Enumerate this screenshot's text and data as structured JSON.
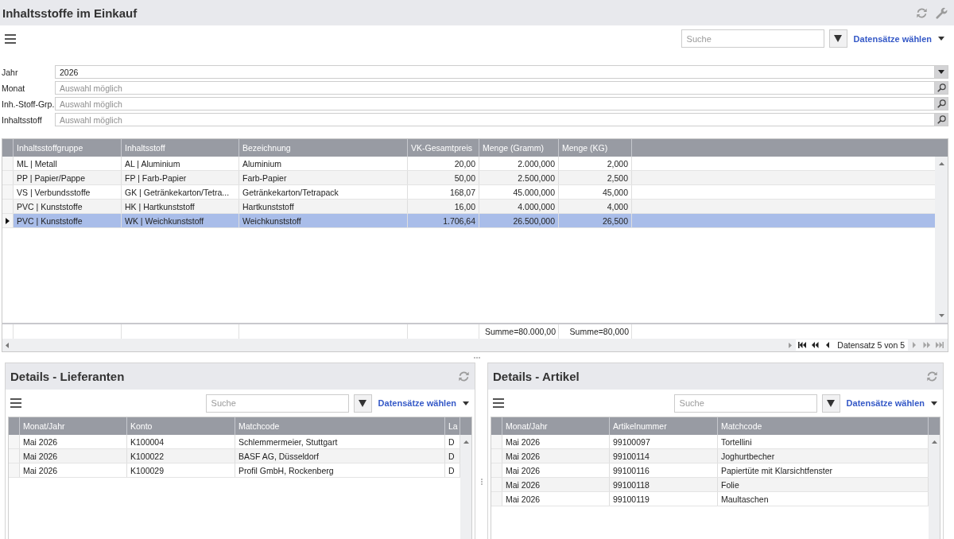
{
  "window": {
    "title": "Inhaltsstoffe im Einkauf"
  },
  "toolbar": {
    "search": {
      "placeholder": "Suche"
    },
    "records_link": "Datensätze wählen"
  },
  "filters": [
    {
      "label": "Jahr",
      "kind": "dropdown",
      "value": "2026"
    },
    {
      "label": "Monat",
      "kind": "lookup",
      "placeholder": "Auswahl möglich"
    },
    {
      "label": "Inh.-Stoff-Grp.",
      "kind": "lookup",
      "placeholder": "Auswahl möglich"
    },
    {
      "label": "Inhaltsstoff",
      "kind": "lookup",
      "placeholder": "Auswahl möglich"
    }
  ],
  "table": {
    "columns": [
      {
        "label": "Inhaltsstoffgruppe",
        "kind": "text"
      },
      {
        "label": "Inhaltsstoff",
        "kind": "text"
      },
      {
        "label": "Bezeichnung",
        "kind": "text"
      },
      {
        "label": "VK-Gesamtpreis",
        "kind": "number"
      },
      {
        "label": "Menge (Gramm)",
        "kind": "number",
        "summary": "Summe=80.000,00"
      },
      {
        "label": "Menge (KG)",
        "kind": "number",
        "summary": "Summe=80,000"
      }
    ],
    "rows": [
      {
        "cells": [
          "ML | Metall",
          "AL | Aluminium",
          "Aluminium",
          "20,00",
          "2.000,000",
          "2,000"
        ],
        "selected": false
      },
      {
        "cells": [
          "PP | Papier/Pappe",
          "FP | Farb-Papier",
          "Farb-Papier",
          "50,00",
          "2.500,000",
          "2,500"
        ],
        "selected": false
      },
      {
        "cells": [
          "VS | Verbundsstoffe",
          "GK | Getränkekarton/Tetra...",
          "Getränkekarton/Tetrapack",
          "168,07",
          "45.000,000",
          "45,000"
        ],
        "selected": false
      },
      {
        "cells": [
          "PVC | Kunststoffe",
          "HK | Hartkunststoff",
          "Hartkunststoff",
          "16,00",
          "4.000,000",
          "4,000"
        ],
        "selected": false
      },
      {
        "cells": [
          "PVC | Kunststoffe",
          "WK | Weichkunststoff",
          "Weichkunststoff",
          "1.706,64",
          "26.500,000",
          "26,500"
        ],
        "selected": true
      }
    ],
    "pager": [
      {
        "kind": "first",
        "disabled": false
      },
      {
        "kind": "prev_page",
        "disabled": false
      },
      {
        "kind": "prev",
        "disabled": false
      },
      {
        "kind": "status",
        "text": "Datensatz 5 von 5"
      },
      {
        "kind": "next",
        "disabled": true
      },
      {
        "kind": "next_page",
        "disabled": true
      },
      {
        "kind": "last",
        "disabled": true
      }
    ]
  },
  "panels": [
    {
      "title": "Details - Lieferanten",
      "search": {
        "placeholder": "Suche"
      },
      "records_link": "Datensätze wählen",
      "table": {
        "columns": [
          {
            "label": "Monat/Jahr"
          },
          {
            "label": "Konto"
          },
          {
            "label": "Matchcode"
          },
          {
            "label": "La"
          }
        ],
        "rows": [
          {
            "cells": [
              "Mai 2026",
              "K100004",
              "Schlemmermeier, Stuttgart",
              "D"
            ],
            "selected": false
          },
          {
            "cells": [
              "Mai 2026",
              "K100022",
              "BASF AG, Düsseldorf",
              "D"
            ],
            "selected": false
          },
          {
            "cells": [
              "Mai 2026",
              "K100029",
              "Profil GmbH, Rockenberg",
              "D"
            ],
            "selected": false
          }
        ]
      }
    },
    {
      "title": "Details - Artikel",
      "search": {
        "placeholder": "Suche"
      },
      "records_link": "Datensätze wählen",
      "table": {
        "columns": [
          {
            "label": "Monat/Jahr"
          },
          {
            "label": "Artikelnummer"
          },
          {
            "label": "Matchcode"
          }
        ],
        "rows": [
          {
            "cells": [
              "Mai 2026",
              "99100097",
              "Tortellini"
            ],
            "selected": false
          },
          {
            "cells": [
              "Mai 2026",
              "99100114",
              "Joghurtbecher"
            ],
            "selected": false
          },
          {
            "cells": [
              "Mai 2026",
              "99100116",
              "Papiertüte mit Klarsichtfenster"
            ],
            "selected": false
          },
          {
            "cells": [
              "Mai 2026",
              "99100118",
              "Folie"
            ],
            "selected": false
          },
          {
            "cells": [
              "Mai 2026",
              "99100119",
              "Maultaschen"
            ],
            "selected": false
          }
        ]
      }
    }
  ]
}
